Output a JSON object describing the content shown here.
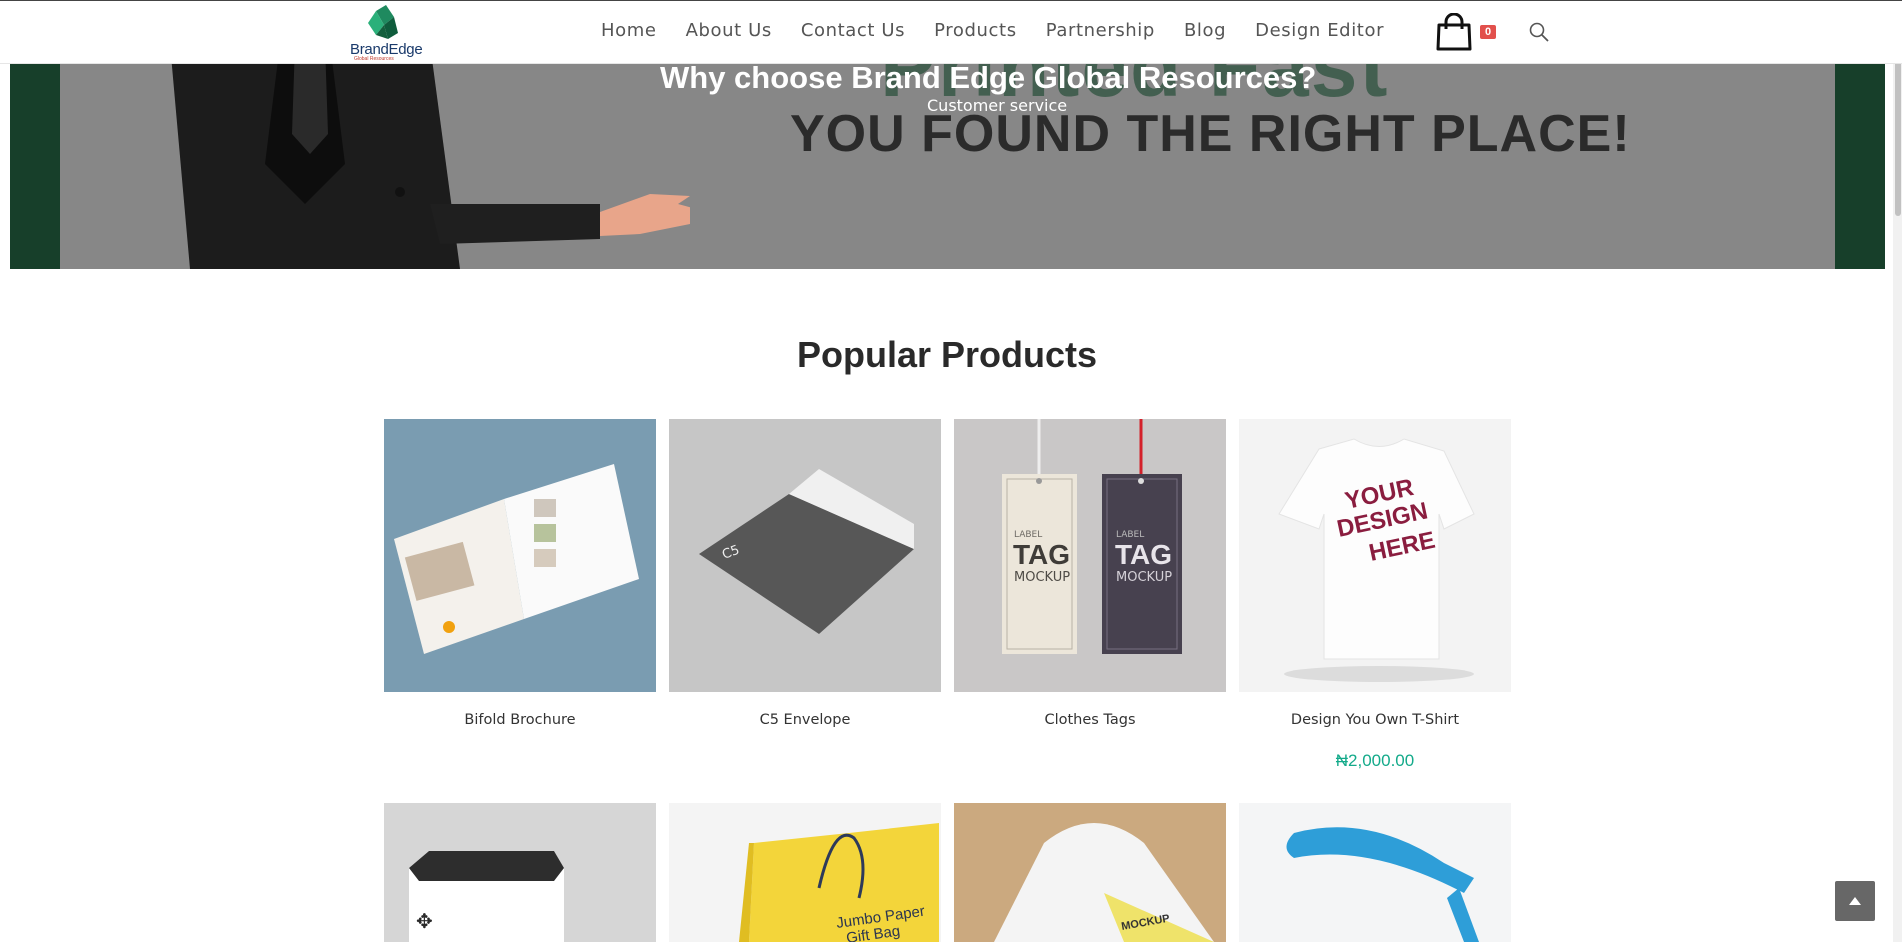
{
  "brand": {
    "name": "BrandEdge",
    "tagline": "Global Resources"
  },
  "nav": [
    {
      "label": "Home"
    },
    {
      "label": "About Us"
    },
    {
      "label": "Contact Us"
    },
    {
      "label": "Products"
    },
    {
      "label": "Partnership"
    },
    {
      "label": "Blog"
    },
    {
      "label": "Design Editor"
    }
  ],
  "cart": {
    "count": "0",
    "icon": "shopping-bag-icon"
  },
  "search": {
    "icon": "search-icon"
  },
  "hero": {
    "title": "Why choose Brand Edge Global Resources?",
    "subtitle": "Customer service",
    "headline": "YOU FOUND THE RIGHT PLACE!",
    "background_word": "Printed Fast"
  },
  "section": {
    "title": "Popular Products"
  },
  "products": [
    {
      "name": "Bifold Brochure",
      "price": ""
    },
    {
      "name": "C5 Envelope",
      "price": ""
    },
    {
      "name": "Clothes Tags",
      "price": ""
    },
    {
      "name": "Design You Own T-Shirt",
      "price": "₦2,000.00"
    }
  ],
  "tag_mockup": {
    "label": "LABEL",
    "tag": "TAG",
    "mockup": "MOCKUP"
  },
  "tshirt_print": {
    "line1": "YOUR",
    "line2": "DESIGN",
    "line3": "HERE"
  },
  "envelope_print": "C5",
  "bag_print": {
    "line1": "Jumbo Paper",
    "line2": "Gift Bag"
  },
  "hoodie_print": "MOCKUP",
  "colors": {
    "accent": "#13aa8a",
    "badge": "#e2504c",
    "hero_green": "#173f2a"
  }
}
